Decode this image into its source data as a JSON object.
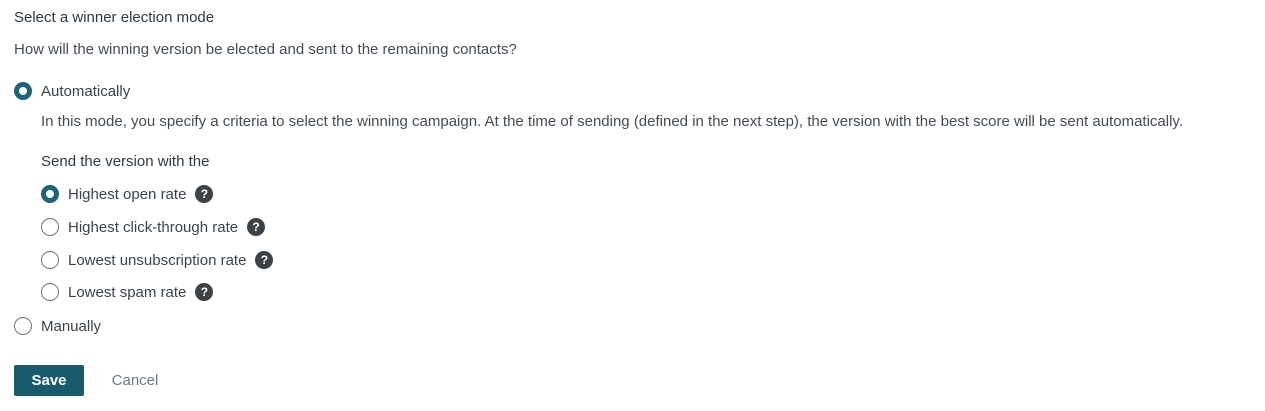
{
  "section": {
    "title": "Select a winner election mode",
    "question": "How will the winning version be elected and sent to the remaining contacts?"
  },
  "modes": {
    "automatic": {
      "label": "Automatically",
      "checked": true,
      "description": "In this mode, you specify a criteria to select the winning campaign. At the time of sending (defined in the next step), the version with the best score will be sent automatically."
    },
    "manual": {
      "label": "Manually",
      "checked": false
    }
  },
  "criteria": {
    "heading": "Send the version with the",
    "options": [
      {
        "label": "Highest open rate",
        "checked": true,
        "help_icon": "question-mark"
      },
      {
        "label": "Highest click-through rate",
        "checked": false,
        "help_icon": "question-mark"
      },
      {
        "label": "Lowest unsubscription rate",
        "checked": false,
        "help_icon": "question-mark"
      },
      {
        "label": "Lowest spam rate",
        "checked": false,
        "help_icon": "question-mark"
      }
    ]
  },
  "help_glyph": "?",
  "actions": {
    "save_label": "Save",
    "cancel_label": "Cancel"
  },
  "colors": {
    "accent": "#1d6477",
    "save_button": "#1a5a6d",
    "help_icon_bg": "#3d4247"
  }
}
